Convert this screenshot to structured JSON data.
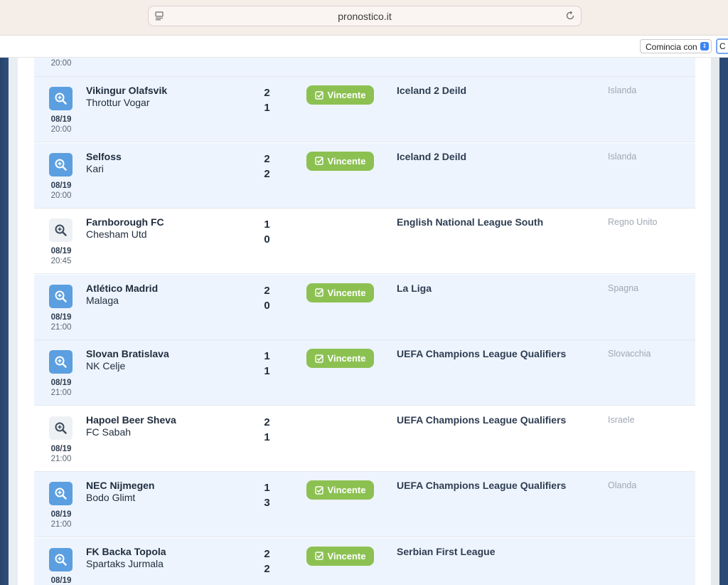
{
  "browser": {
    "url": "pronostico.it",
    "filter_select": "Comincia con",
    "next_input": "C"
  },
  "top_fragment": {
    "time": "20:00"
  },
  "badge_label": "Vincente",
  "matches": [
    {
      "home": "Vikingur Olafsvik",
      "away": "Throttur Vogar",
      "home_score": "2",
      "away_score": "1",
      "date": "08/19",
      "time": "20:00",
      "league": "Iceland 2 Deild",
      "country": "Islanda",
      "highlighted": true
    },
    {
      "home": "Selfoss",
      "away": "Kari",
      "home_score": "2",
      "away_score": "2",
      "date": "08/19",
      "time": "20:00",
      "league": "Iceland 2 Deild",
      "country": "Islanda",
      "highlighted": true
    },
    {
      "home": "Farnborough FC",
      "away": "Chesham Utd",
      "home_score": "1",
      "away_score": "0",
      "date": "08/19",
      "time": "20:45",
      "league": "English National League South",
      "country": "Regno Unito",
      "highlighted": false
    },
    {
      "home": "Atlético Madrid",
      "away": "Malaga",
      "home_score": "2",
      "away_score": "0",
      "date": "08/19",
      "time": "21:00",
      "league": "La Liga",
      "country": "Spagna",
      "highlighted": true
    },
    {
      "home": "Slovan Bratislava",
      "away": "NK Celje",
      "home_score": "1",
      "away_score": "1",
      "date": "08/19",
      "time": "21:00",
      "league": "UEFA Champions League Qualifiers",
      "country": "Slovacchia",
      "highlighted": true
    },
    {
      "home": "Hapoel Beer Sheva",
      "away": "FC Sabah",
      "home_score": "2",
      "away_score": "1",
      "date": "08/19",
      "time": "21:00",
      "league": "UEFA Champions League Qualifiers",
      "country": "Israele",
      "highlighted": false
    },
    {
      "home": "NEC Nijmegen",
      "away": "Bodo Glimt",
      "home_score": "1",
      "away_score": "3",
      "date": "08/19",
      "time": "21:00",
      "league": "UEFA Champions League Qualifiers",
      "country": "Olanda",
      "highlighted": true
    },
    {
      "home": "FK Backa Topola",
      "away": "Spartaks Jurmala",
      "home_score": "2",
      "away_score": "2",
      "date": "08/19",
      "time": "",
      "league": "Serbian First League",
      "country": "",
      "highlighted": true
    }
  ]
}
